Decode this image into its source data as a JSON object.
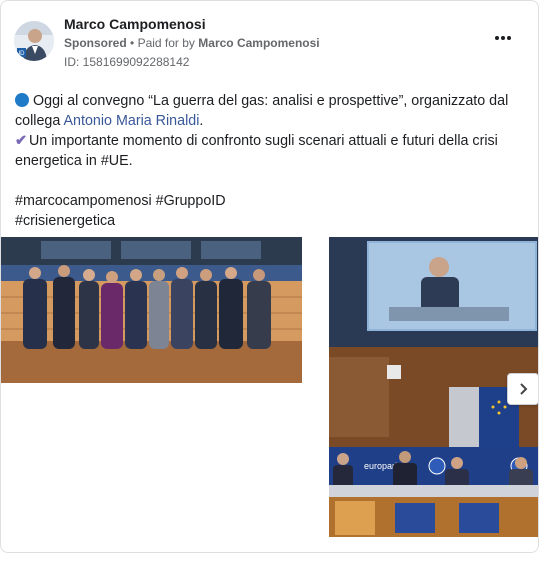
{
  "post": {
    "author": "Marco Campomenosi",
    "sponsored_label": "Sponsored",
    "paid_for_prefix": "Paid for by",
    "payer": "Marco Campomenosi",
    "ad_id": "ID: 1581699092288142",
    "line1": "Oggi al convegno “La guerra del gas: analisi e prospettive”, organizzato dal",
    "line2_prefix": "collega ",
    "line2_link": "Antonio Maria Rinaldi",
    "line2_suffix": ".",
    "line3": "Un importante momento di confronto sugli scenari attuali e futuri della crisi",
    "line4": "energetica in #UE.",
    "hashtags_line1": "#marcocampomenosi #GruppoID",
    "hashtags_line2": "#crisienergetica"
  },
  "icons": {
    "bullet": "blue-circle-icon",
    "check": "check-mark-icon",
    "more": "more-options-icon",
    "next": "chevron-right-icon"
  },
  "text_in_images": {
    "slide2_banner": "europarl.eu"
  },
  "colors": {
    "link": "#385898",
    "secondary_text": "#65676b",
    "blue_dot": "#1f7ac8",
    "check": "#7b6ab8"
  }
}
